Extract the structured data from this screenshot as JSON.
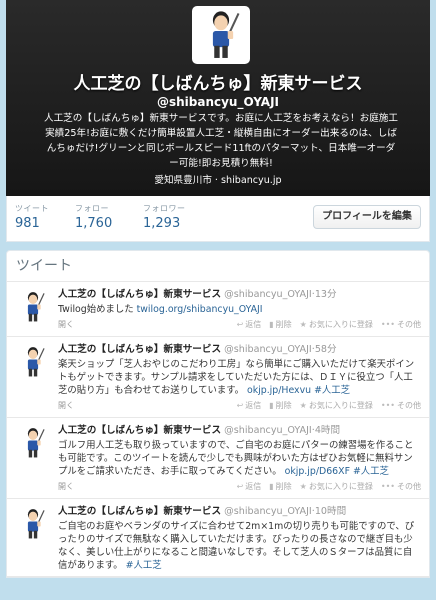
{
  "profile": {
    "name": "人工芝の【しばんちゅ】新東サービス",
    "handle": "@shibancyu_OYAJI",
    "bio": "人工芝の【しばんちゅ】新東サービスです。お庭に人工芝をお考えなら！お庭施工実績25年!お庭に敷くだけ簡単設置人工芝・縦横自由にオーダー出来るのは、しばんちゅだけ!グリーンと同じボールスピード11ftのパターマット、日本唯一オーダー可能!即お見積り無料!",
    "location": "愛知県豊川市",
    "separator": "·",
    "website": "shibancyu.jp"
  },
  "stats": [
    {
      "label": "ツイート",
      "value": "981"
    },
    {
      "label": "フォロー",
      "value": "1,760"
    },
    {
      "label": "フォロワー",
      "value": "1,293"
    }
  ],
  "edit_profile_label": "プロフィールを編集",
  "timeline_title": "ツイート",
  "actions": {
    "reply": "返信",
    "delete": "削除",
    "favorite": "お気に入りに登録",
    "more": "その他",
    "open": "開く"
  },
  "tweets": [
    {
      "name": "人工芝の【しばんちゅ】新東サービス",
      "handle": "@shibancyu_OYAJI",
      "time": "13分",
      "text": "Twilog始めました ",
      "link": "twilog.org/shibancyu_OYAJI",
      "tail": "",
      "tag": ""
    },
    {
      "name": "人工芝の【しばんちゅ】新東サービス",
      "handle": "@shibancyu_OYAJI",
      "time": "58分",
      "text": "楽天ショップ「芝人おやじのこだわり工房」なら簡単にご購入いただけて楽天ポイントもゲットできます。サンプル請求をしていただいた方には、ＤＩＹに役立つ「人工芝の貼り方」も合わせてお送りしています。 ",
      "link": "okjp.jp/Hexvu",
      "tail": " ",
      "tag": "#人工芝"
    },
    {
      "name": "人工芝の【しばんちゅ】新東サービス",
      "handle": "@shibancyu_OYAJI",
      "time": "4時間",
      "text": "ゴルフ用人工芝も取り扱っていますので、ご自宅のお庭にパターの練習場を作ることも可能です。このツイートを読んで少しでも興味がわいた方はぜひお気軽に無料サンプルをご請求いただき、お手に取ってみてください。 ",
      "link": "okjp.jp/D66XF",
      "tail": " ",
      "tag": "#人工芝"
    },
    {
      "name": "人工芝の【しばんちゅ】新東サービス",
      "handle": "@shibancyu_OYAJI",
      "time": "10時間",
      "text": "ご自宅のお庭やベランダのサイズに合わせて2m×1mの切り売りも可能ですので、ぴったりのサイズで無駄なく購入していただけます。ぴったりの長さなので継ぎ目も少なく、美しい仕上がりになること間違いなしです。そして芝人のＳターフは品質に自信があります。",
      "link": "",
      "tail": " ",
      "tag": "#人工芝"
    }
  ]
}
